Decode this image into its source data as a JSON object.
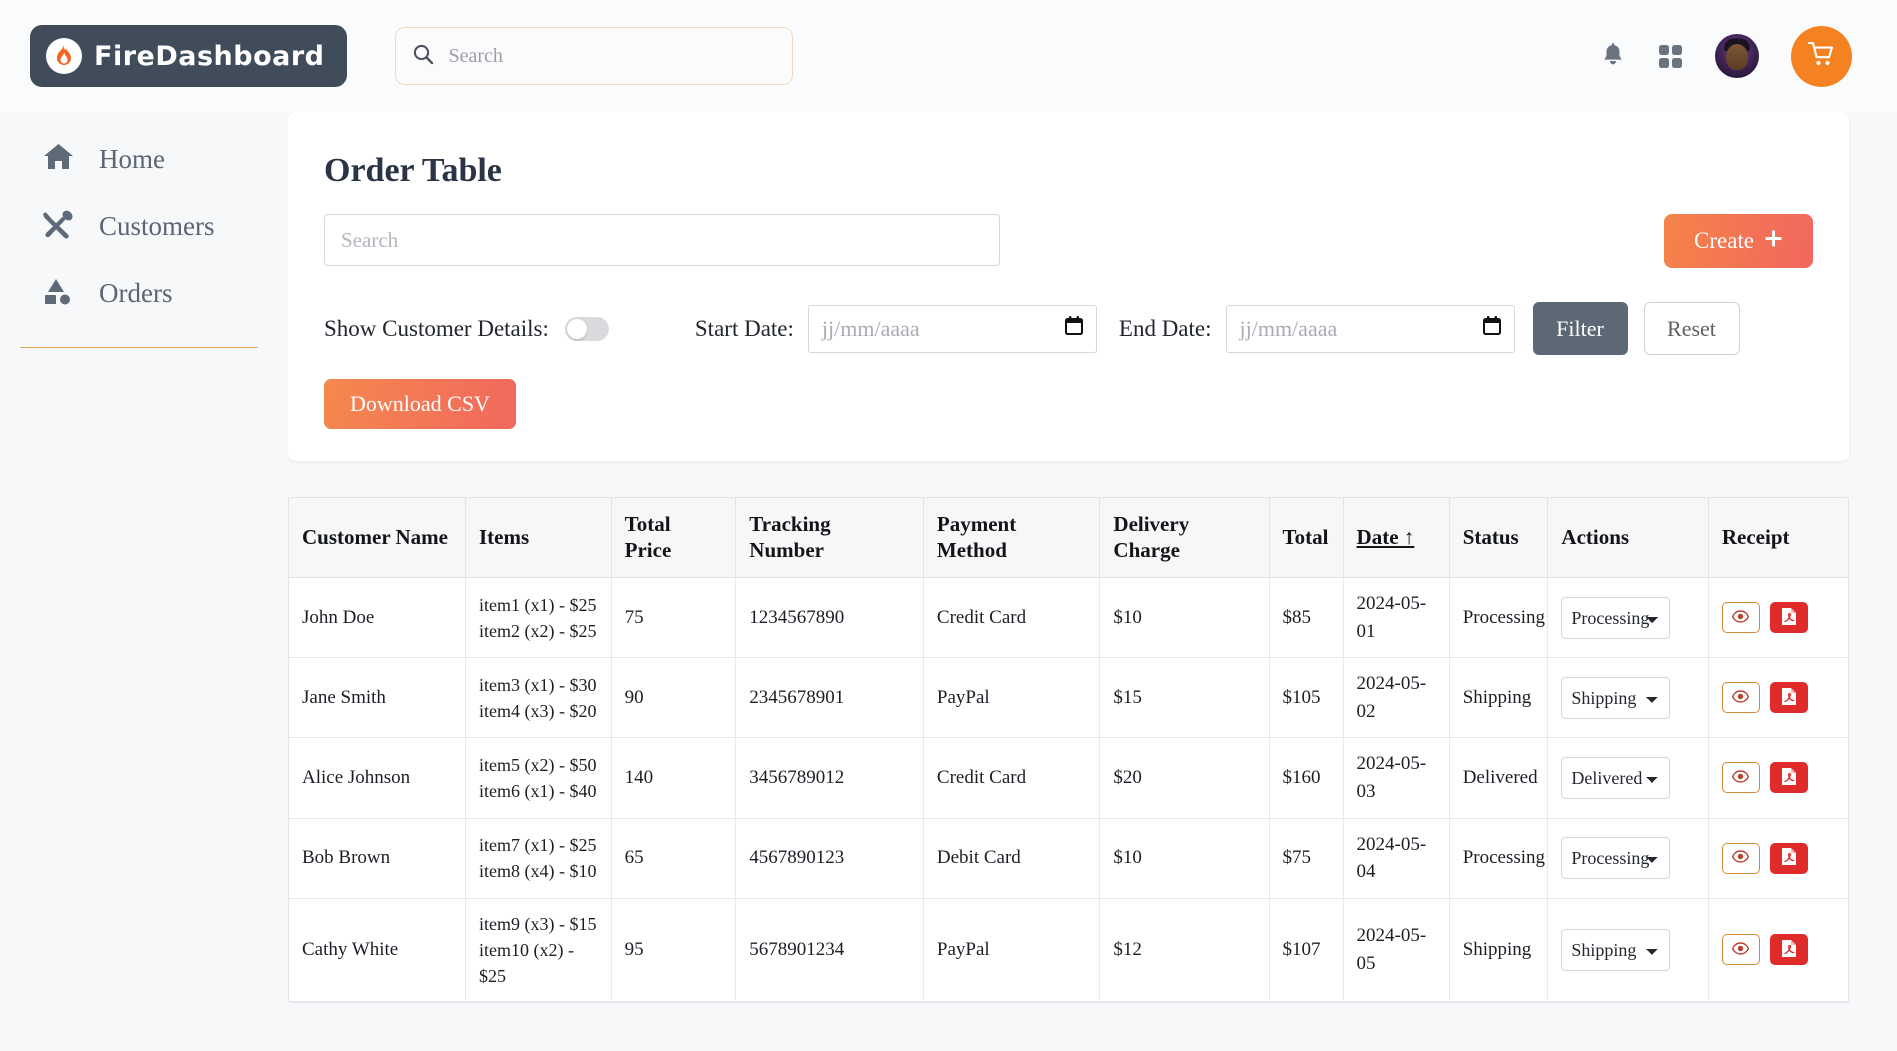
{
  "brand": {
    "name": "FireDashboard",
    "logo_icon": "flame-icon",
    "accent": "#f58220"
  },
  "topbar": {
    "search": {
      "placeholder": "Search",
      "value": "",
      "icon": "search-icon"
    },
    "notifications_icon": "bell-icon",
    "apps_icon": "grid-apps-icon",
    "avatar_label": "user-avatar",
    "cart_icon": "shopping-cart-icon"
  },
  "sidebar": {
    "items": [
      {
        "label": "Home",
        "icon": "home-icon"
      },
      {
        "label": "Customers",
        "icon": "fork-spoon-icon"
      },
      {
        "label": "Orders",
        "icon": "shapes-icon"
      }
    ]
  },
  "panel": {
    "title": "Order Table",
    "search": {
      "placeholder": "Search",
      "value": ""
    },
    "create_label": "Create",
    "create_icon": "plus-icon",
    "toggle_label": "Show Customer Details:",
    "toggle_state": "off",
    "start_date_label": "Start Date:",
    "start_date_placeholder": "jj/mm/aaaa",
    "start_date_value": "",
    "end_date_label": "End Date:",
    "end_date_placeholder": "jj/mm/aaaa",
    "end_date_value": "",
    "calendar_icon": "calendar-icon",
    "filter_label": "Filter",
    "reset_label": "Reset",
    "download_label": "Download CSV"
  },
  "table": {
    "headers": [
      "Customer Name",
      "Items",
      "Total Price",
      "Tracking Number",
      "Payment Method",
      "Delivery Charge",
      "Total",
      "Date ↑",
      "Status",
      "Actions",
      "Receipt"
    ],
    "sort_column": "Date",
    "sort_direction": "asc",
    "status_options": [
      "Processing",
      "Shipping",
      "Delivered"
    ],
    "rows": [
      {
        "customer": "John Doe",
        "items": "item1 (x1) - $25\nitem2 (x2) - $25",
        "total_price": "75",
        "tracking": "1234567890",
        "payment": "Credit Card",
        "delivery": "$10",
        "total": "$85",
        "date": "2024-05-01",
        "status": "Processing",
        "action_status": "Processing"
      },
      {
        "customer": "Jane Smith",
        "items": "item3 (x1) - $30\nitem4 (x3) - $20",
        "total_price": "90",
        "tracking": "2345678901",
        "payment": "PayPal",
        "delivery": "$15",
        "total": "$105",
        "date": "2024-05-02",
        "status": "Shipping",
        "action_status": "Shipping"
      },
      {
        "customer": "Alice Johnson",
        "items": "item5 (x2) - $50\nitem6 (x1) - $40",
        "total_price": "140",
        "tracking": "3456789012",
        "payment": "Credit Card",
        "delivery": "$20",
        "total": "$160",
        "date": "2024-05-03",
        "status": "Delivered",
        "action_status": "Delivered"
      },
      {
        "customer": "Bob Brown",
        "items": "item7 (x1) - $25\nitem8 (x4) - $10",
        "total_price": "65",
        "tracking": "4567890123",
        "payment": "Debit Card",
        "delivery": "$10",
        "total": "$75",
        "date": "2024-05-04",
        "status": "Processing",
        "action_status": "Processing"
      },
      {
        "customer": "Cathy White",
        "items": "item9 (x3) - $15\nitem10 (x2) - $25",
        "total_price": "95",
        "tracking": "5678901234",
        "payment": "PayPal",
        "delivery": "$12",
        "total": "$107",
        "date": "2024-05-05",
        "status": "Shipping",
        "action_status": "Shipping"
      }
    ],
    "receipt_view_icon": "eye-icon",
    "receipt_pdf_icon": "pdf-file-icon"
  }
}
